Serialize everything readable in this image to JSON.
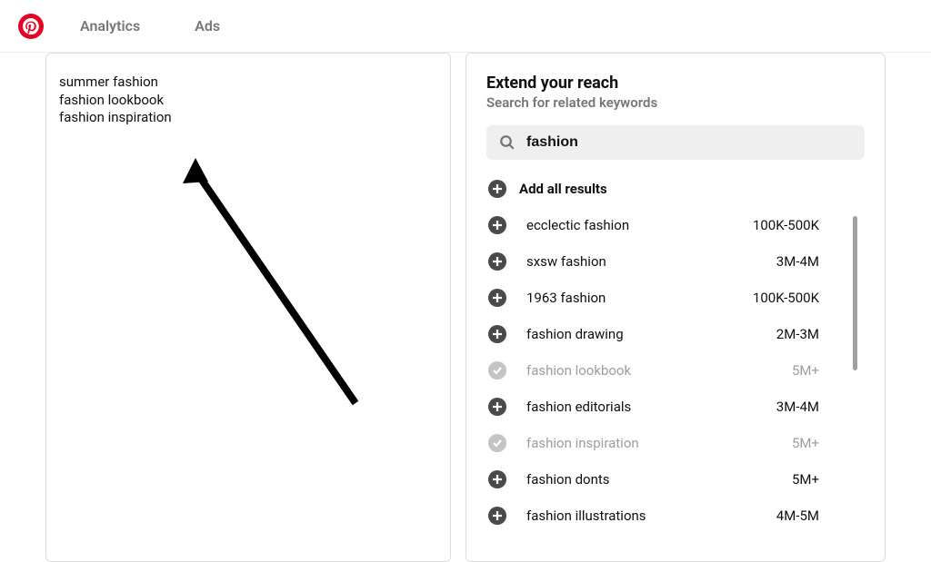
{
  "header": {
    "nav": {
      "analytics": "Analytics",
      "ads": "Ads"
    }
  },
  "left": {
    "selected": [
      "summer fashion",
      "fashion lookbook",
      "fashion inspiration"
    ]
  },
  "right": {
    "title": "Extend your reach",
    "subtitle": "Search for related keywords",
    "search_value": "fashion",
    "add_all_label": "Add all results",
    "results": [
      {
        "label": "ecclectic fashion",
        "volume": "100K-500K",
        "added": false
      },
      {
        "label": "sxsw fashion",
        "volume": "3M-4M",
        "added": false
      },
      {
        "label": "1963 fashion",
        "volume": "100K-500K",
        "added": false
      },
      {
        "label": "fashion drawing",
        "volume": "2M-3M",
        "added": false
      },
      {
        "label": "fashion lookbook",
        "volume": "5M+",
        "added": true
      },
      {
        "label": "fashion editorials",
        "volume": "3M-4M",
        "added": false
      },
      {
        "label": "fashion inspiration",
        "volume": "5M+",
        "added": true
      },
      {
        "label": "fashion donts",
        "volume": "5M+",
        "added": false
      },
      {
        "label": "fashion illustrations",
        "volume": "4M-5M",
        "added": false
      }
    ]
  }
}
